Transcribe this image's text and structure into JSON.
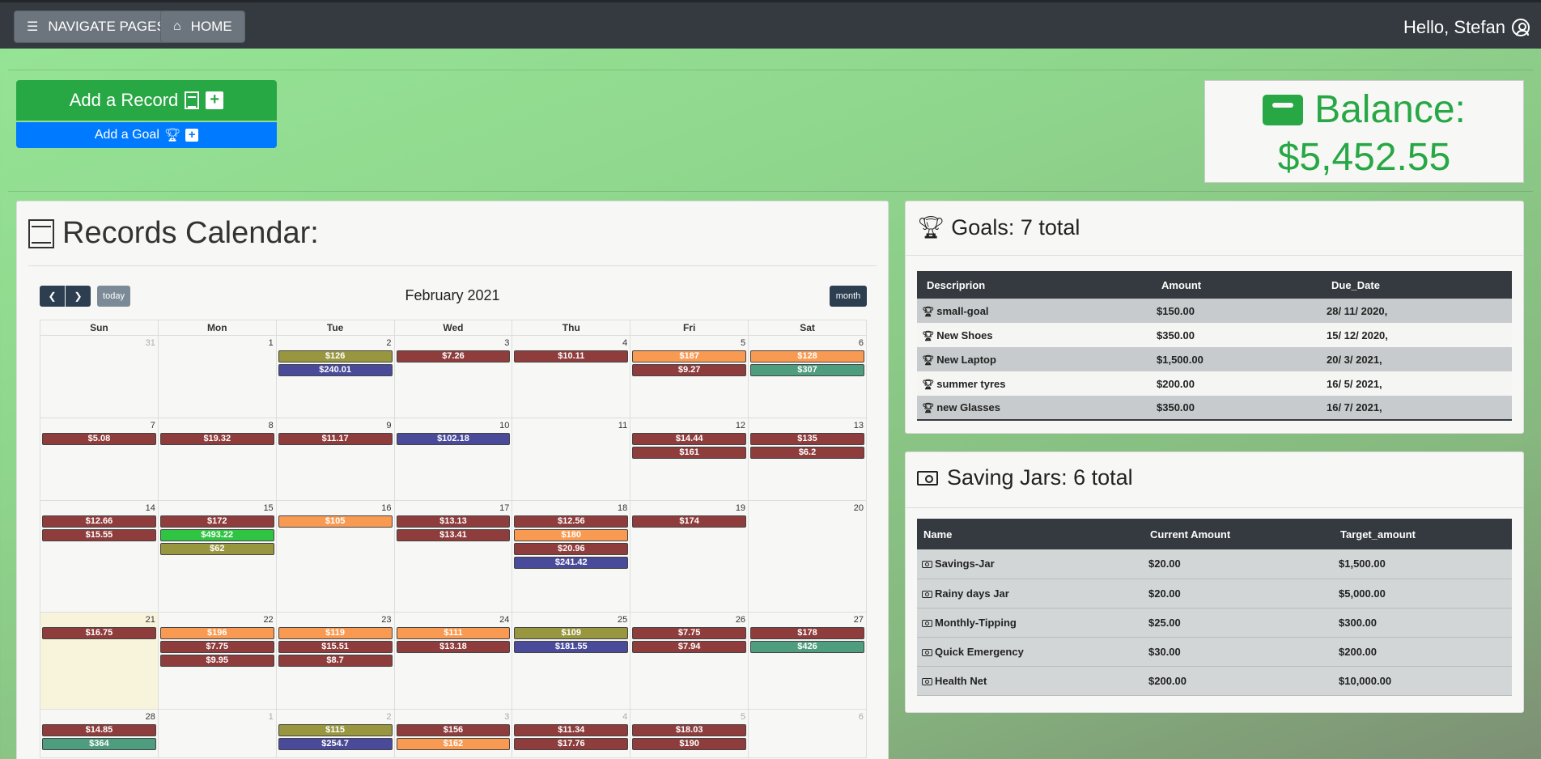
{
  "nav": {
    "navigate_label": "NAVIGATE PAGES",
    "home_label": "HOME",
    "greeting": "Hello, Stefan"
  },
  "actions": {
    "add_record": "Add a Record",
    "add_goal": "Add a Goal"
  },
  "balance": {
    "label": "Balance:",
    "value": "$5,452.55"
  },
  "calendar": {
    "title": "Records Calendar:",
    "heading": "February 2021",
    "today_label": "today",
    "month_label": "month",
    "weekdays": [
      "Sun",
      "Mon",
      "Tue",
      "Wed",
      "Thu",
      "Fri",
      "Sat"
    ],
    "colors": {
      "red": "#8f3c3c",
      "olive": "#999640",
      "blue": "#4a4a9a",
      "orange": "#f99a52",
      "green": "#2fc442",
      "teal": "#4e9d7e"
    },
    "weeks": [
      [
        {
          "day": "31",
          "other": true,
          "events": []
        },
        {
          "day": "1",
          "events": []
        },
        {
          "day": "2",
          "events": [
            {
              "label": "$126",
              "color": "olive"
            },
            {
              "label": "$240.01",
              "color": "blue"
            }
          ]
        },
        {
          "day": "3",
          "events": [
            {
              "label": "$7.26",
              "color": "red"
            }
          ]
        },
        {
          "day": "4",
          "events": [
            {
              "label": "$10.11",
              "color": "red"
            }
          ]
        },
        {
          "day": "5",
          "events": [
            {
              "label": "$187",
              "color": "orange"
            },
            {
              "label": "$9.27",
              "color": "red"
            }
          ]
        },
        {
          "day": "6",
          "events": [
            {
              "label": "$128",
              "color": "orange"
            },
            {
              "label": "$307",
              "color": "teal"
            }
          ]
        }
      ],
      [
        {
          "day": "7",
          "events": [
            {
              "label": "$5.08",
              "color": "red"
            }
          ]
        },
        {
          "day": "8",
          "events": [
            {
              "label": "$19.32",
              "color": "red"
            }
          ]
        },
        {
          "day": "9",
          "events": [
            {
              "label": "$11.17",
              "color": "red"
            }
          ]
        },
        {
          "day": "10",
          "events": [
            {
              "label": "$102.18",
              "color": "blue"
            }
          ]
        },
        {
          "day": "11",
          "events": []
        },
        {
          "day": "12",
          "events": [
            {
              "label": "$14.44",
              "color": "red"
            },
            {
              "label": "$161",
              "color": "red"
            }
          ]
        },
        {
          "day": "13",
          "events": [
            {
              "label": "$135",
              "color": "red"
            },
            {
              "label": "$6.2",
              "color": "red"
            }
          ]
        }
      ],
      [
        {
          "day": "14",
          "events": [
            {
              "label": "$12.66",
              "color": "red"
            },
            {
              "label": "$15.55",
              "color": "red"
            }
          ]
        },
        {
          "day": "15",
          "events": [
            {
              "label": "$172",
              "color": "red"
            },
            {
              "label": "$493.22",
              "color": "green"
            },
            {
              "label": "$62",
              "color": "olive"
            }
          ]
        },
        {
          "day": "16",
          "events": [
            {
              "label": "$105",
              "color": "orange"
            }
          ]
        },
        {
          "day": "17",
          "events": [
            {
              "label": "$13.13",
              "color": "red"
            },
            {
              "label": "$13.41",
              "color": "red"
            }
          ]
        },
        {
          "day": "18",
          "events": [
            {
              "label": "$12.56",
              "color": "red"
            },
            {
              "label": "$180",
              "color": "orange"
            },
            {
              "label": "$20.96",
              "color": "red"
            },
            {
              "label": "$241.42",
              "color": "blue"
            }
          ]
        },
        {
          "day": "19",
          "events": [
            {
              "label": "$174",
              "color": "red"
            }
          ]
        },
        {
          "day": "20",
          "events": []
        }
      ],
      [
        {
          "day": "21",
          "today": true,
          "events": [
            {
              "label": "$16.75",
              "color": "red"
            }
          ]
        },
        {
          "day": "22",
          "events": [
            {
              "label": "$196",
              "color": "orange"
            },
            {
              "label": "$7.75",
              "color": "red"
            },
            {
              "label": "$9.95",
              "color": "red"
            }
          ]
        },
        {
          "day": "23",
          "events": [
            {
              "label": "$119",
              "color": "orange"
            },
            {
              "label": "$15.51",
              "color": "red"
            },
            {
              "label": "$8.7",
              "color": "red"
            }
          ]
        },
        {
          "day": "24",
          "events": [
            {
              "label": "$111",
              "color": "orange"
            },
            {
              "label": "$13.18",
              "color": "red"
            }
          ]
        },
        {
          "day": "25",
          "events": [
            {
              "label": "$109",
              "color": "olive"
            },
            {
              "label": "$181.55",
              "color": "blue"
            }
          ]
        },
        {
          "day": "26",
          "events": [
            {
              "label": "$7.75",
              "color": "red"
            },
            {
              "label": "$7.94",
              "color": "red"
            }
          ]
        },
        {
          "day": "27",
          "events": [
            {
              "label": "$178",
              "color": "red"
            },
            {
              "label": "$426",
              "color": "teal"
            }
          ]
        }
      ],
      [
        {
          "day": "28",
          "events": [
            {
              "label": "$14.85",
              "color": "red"
            },
            {
              "label": "$364",
              "color": "teal"
            }
          ]
        },
        {
          "day": "1",
          "other": true,
          "events": []
        },
        {
          "day": "2",
          "other": true,
          "events": [
            {
              "label": "$115",
              "color": "olive"
            },
            {
              "label": "$254.7",
              "color": "blue"
            }
          ]
        },
        {
          "day": "3",
          "other": true,
          "events": [
            {
              "label": "$156",
              "color": "red"
            },
            {
              "label": "$162",
              "color": "orange"
            }
          ]
        },
        {
          "day": "4",
          "other": true,
          "events": [
            {
              "label": "$11.34",
              "color": "red"
            },
            {
              "label": "$17.76",
              "color": "red"
            }
          ]
        },
        {
          "day": "5",
          "other": true,
          "events": [
            {
              "label": "$18.03",
              "color": "red"
            },
            {
              "label": "$190",
              "color": "red"
            }
          ]
        },
        {
          "day": "6",
          "other": true,
          "events": []
        }
      ]
    ]
  },
  "goals": {
    "title": "Goals: 7 total",
    "headers": [
      "Descriprion",
      "Amount",
      "Due_Date"
    ],
    "rows": [
      [
        "small-goal",
        "$150.00",
        "28/ 11/ 2020,"
      ],
      [
        "New Shoes",
        "$350.00",
        "15/ 12/ 2020,"
      ],
      [
        "New Laptop",
        "$1,500.00",
        "20/ 3/ 2021,"
      ],
      [
        "summer tyres",
        "$200.00",
        "16/ 5/ 2021,"
      ],
      [
        "new Glasses",
        "$350.00",
        "16/ 7/ 2021,"
      ]
    ]
  },
  "jars": {
    "title": "Saving Jars: 6 total",
    "headers": [
      "Name",
      "Current Amount",
      "Target_amount"
    ],
    "rows": [
      [
        "Savings-Jar",
        "$20.00",
        "$1,500.00"
      ],
      [
        "Rainy days Jar",
        "$20.00",
        "$5,000.00"
      ],
      [
        "Monthly-Tipping",
        "$25.00",
        "$300.00"
      ],
      [
        "Quick Emergency",
        "$30.00",
        "$200.00"
      ],
      [
        "Health Net",
        "$200.00",
        "$10,000.00"
      ]
    ]
  }
}
